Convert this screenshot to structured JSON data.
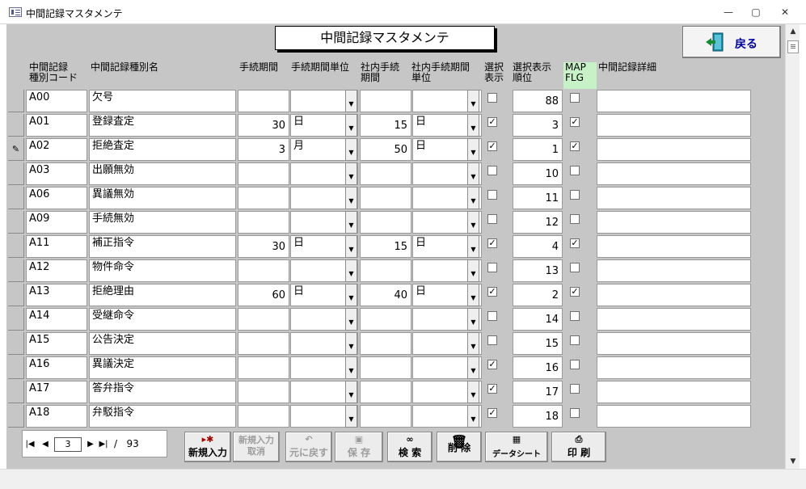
{
  "window": {
    "title": "中間記録マスタメンテ",
    "minimize": "—",
    "maximize": "▢",
    "close": "✕"
  },
  "form": {
    "title": "中間記録マスタメンテ",
    "back_label": "戻る"
  },
  "columns": {
    "code": "中間記録\n種別コード",
    "name": "中間記録種別名",
    "period": "手続期間",
    "period_unit": "手続期間単位",
    "internal": "社内手続\n期間",
    "internal_unit": "社内手続期間\n単位",
    "select_show": "選択\n表示",
    "order": "選択表示\n順位",
    "mapflg": "MAP\nFLG",
    "detail": "中間記録詳細"
  },
  "rows": [
    {
      "marker": "",
      "code": "A00",
      "name": "欠号",
      "period": "",
      "unit": "",
      "internal": "",
      "internal_unit": "",
      "show": false,
      "order": "88",
      "map": false
    },
    {
      "marker": "",
      "code": "A01",
      "name": "登録査定",
      "period": "30",
      "unit": "日",
      "internal": "15",
      "internal_unit": "日",
      "show": true,
      "order": "3",
      "map": true
    },
    {
      "marker": "✎",
      "code": "A02",
      "name": "拒絶査定",
      "period": "3",
      "unit": "月",
      "internal": "50",
      "internal_unit": "日",
      "show": true,
      "order": "1",
      "map": true
    },
    {
      "marker": "",
      "code": "A03",
      "name": "出願無効",
      "period": "",
      "unit": "",
      "internal": "",
      "internal_unit": "",
      "show": false,
      "order": "10",
      "map": false
    },
    {
      "marker": "",
      "code": "A06",
      "name": "異議無効",
      "period": "",
      "unit": "",
      "internal": "",
      "internal_unit": "",
      "show": false,
      "order": "11",
      "map": false
    },
    {
      "marker": "",
      "code": "A09",
      "name": "手続無効",
      "period": "",
      "unit": "",
      "internal": "",
      "internal_unit": "",
      "show": false,
      "order": "12",
      "map": false
    },
    {
      "marker": "",
      "code": "A11",
      "name": "補正指令",
      "period": "30",
      "unit": "日",
      "internal": "15",
      "internal_unit": "日",
      "show": true,
      "order": "4",
      "map": true
    },
    {
      "marker": "",
      "code": "A12",
      "name": "物件命令",
      "period": "",
      "unit": "",
      "internal": "",
      "internal_unit": "",
      "show": false,
      "order": "13",
      "map": false
    },
    {
      "marker": "",
      "code": "A13",
      "name": "拒絶理由",
      "period": "60",
      "unit": "日",
      "internal": "40",
      "internal_unit": "日",
      "show": true,
      "order": "2",
      "map": true
    },
    {
      "marker": "",
      "code": "A14",
      "name": "受継命令",
      "period": "",
      "unit": "",
      "internal": "",
      "internal_unit": "",
      "show": false,
      "order": "14",
      "map": false
    },
    {
      "marker": "",
      "code": "A15",
      "name": "公告決定",
      "period": "",
      "unit": "",
      "internal": "",
      "internal_unit": "",
      "show": false,
      "order": "15",
      "map": false
    },
    {
      "marker": "",
      "code": "A16",
      "name": "異議決定",
      "period": "",
      "unit": "",
      "internal": "",
      "internal_unit": "",
      "show": true,
      "order": "16",
      "map": false
    },
    {
      "marker": "",
      "code": "A17",
      "name": "答弁指令",
      "period": "",
      "unit": "",
      "internal": "",
      "internal_unit": "",
      "show": true,
      "order": "17",
      "map": false
    },
    {
      "marker": "",
      "code": "A18",
      "name": "弁駁指令",
      "period": "",
      "unit": "",
      "internal": "",
      "internal_unit": "",
      "show": true,
      "order": "18",
      "map": false
    }
  ],
  "navigator": {
    "current": "3",
    "separator": "/",
    "total": "93"
  },
  "buttons": {
    "new": "新規入力",
    "cancel_new": "新規入力\n取消",
    "undo": "元に戻す",
    "save": "保 存",
    "search": "検 索",
    "delete": "削 除",
    "datasheet": "データシート",
    "print": "印 刷"
  },
  "colors": {
    "form_bg": "#c6c6c6",
    "mapflg_header_bg": "#c7f2c7",
    "back_label": "#0000a0"
  }
}
